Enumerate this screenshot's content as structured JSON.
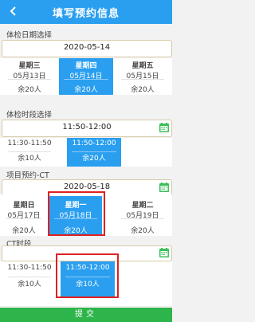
{
  "header": {
    "title": "填写预约信息",
    "back_icon": "chevron-left-icon"
  },
  "date_section": {
    "label": "体检日期选择",
    "picker_value": "2020-05-14",
    "days": [
      {
        "weekday": "星期三",
        "date": "05月13日",
        "remain": "余20人",
        "selected": false
      },
      {
        "weekday": "星期四",
        "date": "05月14日",
        "remain": "余20人",
        "selected": true
      },
      {
        "weekday": "星期五",
        "date": "05月15日",
        "remain": "余20人",
        "selected": false
      }
    ]
  },
  "time_section": {
    "label": "体检时段选择",
    "picker_value": "11:50-12:00",
    "slots": [
      {
        "time": "11:30-11:50",
        "remain": "余10人",
        "selected": false
      },
      {
        "time": "11:50-12:00",
        "remain": "余20人",
        "selected": true
      },
      {
        "time": "",
        "remain": "",
        "selected": false
      }
    ]
  },
  "project_section": {
    "label": "项目预约-CT",
    "picker_value": "2020-05-18",
    "days": [
      {
        "weekday": "星期日",
        "date": "05月17日",
        "remain": "余20人",
        "selected": false
      },
      {
        "weekday": "星期一",
        "date": "05月18日",
        "remain": "余20人",
        "selected": true
      },
      {
        "weekday": "星期二",
        "date": "05月19日",
        "remain": "余20人",
        "selected": false
      }
    ]
  },
  "ct_section": {
    "label": "CT时段",
    "picker_value": "",
    "slots": [
      {
        "time": "11:30-11:50",
        "remain": "余10人",
        "selected": false
      },
      {
        "time": "11:50-12:00",
        "remain": "余10人",
        "selected": true
      },
      {
        "time": "",
        "remain": "",
        "selected": false
      }
    ]
  },
  "submit_label": "提交",
  "colors": {
    "primary": "#2a9ff0",
    "submit": "#2db44a",
    "highlight": "#e02020"
  }
}
